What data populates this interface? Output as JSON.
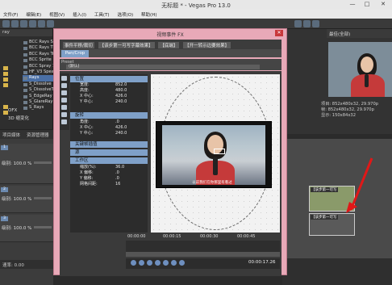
{
  "window": {
    "title": "无标题 * - Vegas Pro 13.0",
    "minimize": "—",
    "maximize": "□",
    "close": "✕"
  },
  "menu": [
    "文件(F)",
    "编辑(E)",
    "视图(V)",
    "插入(I)",
    "工具(T)",
    "选项(O)",
    "帮助(H)"
  ],
  "left_panel": {
    "path": "ray",
    "plugins": [
      "BCC Rays Sh",
      "BCC Rays Ti",
      "BCC Rays Tr",
      "BCC Sprite 1",
      "BCC Spray 1",
      "HF_V3 Spea",
      "Rays",
      "S_Dissolve",
      "S_DissolveT",
      "S_EdgeRay",
      "S_GlareRay",
      "S_Rays"
    ],
    "selected_plugin": "Rays",
    "tree": [
      "OFX",
      "3D 缩变化"
    ],
    "footer_tabs": [
      "项目媒体",
      "资源管理器"
    ]
  },
  "tracks": [
    {
      "num": "1",
      "level_label": "级别: 100.0 %"
    },
    {
      "num": "2",
      "level_label": "级别: 100.0 %"
    },
    {
      "num": "3",
      "level_label": "级别: 100.0 %"
    }
  ],
  "rate_label": "速率: 0.00",
  "dialog": {
    "title": "视频事件 FX",
    "close": "✕",
    "chain": [
      "事件平移/裁切",
      "【该步第一可写字幕效果】",
      "【底端】",
      "【开一转示边要效果】"
    ],
    "tab": "Pan/Crop",
    "preset_label": "Preset",
    "preset_value": "(默认)",
    "sections": {
      "position": "位置",
      "rotation": "旋转",
      "keyframe_interp": "关键帧插值",
      "source": "源",
      "workspace": "工作区"
    },
    "position_rows": [
      {
        "k": "宽度:",
        "v": "852.0"
      },
      {
        "k": "高度:",
        "v": "480.0"
      },
      {
        "k": "X 中心:",
        "v": "426.0"
      },
      {
        "k": "Y 中心:",
        "v": "240.0"
      }
    ],
    "rotation_rows": [
      {
        "k": "角度:",
        "v": ".0"
      },
      {
        "k": "X 中心:",
        "v": "426.0"
      },
      {
        "k": "Y 中心:",
        "v": "240.0"
      }
    ],
    "workspace_rows": [
      {
        "k": "缩放(%):",
        "v": "36.0"
      },
      {
        "k": "X 偏移:",
        "v": ".0"
      },
      {
        "k": "Y 偏移:",
        "v": ".0"
      },
      {
        "k": "网格间距:",
        "v": "16"
      }
    ],
    "subtitle": "以前我们在你那里有看过",
    "ruler": [
      "00:00:00",
      "00:00:15",
      "00:00:30",
      "00:00:45"
    ],
    "timecode": "00:00:17.26"
  },
  "preview": {
    "toolbar": "最佳(全部)",
    "info": [
      "项目: 852x480x32, 29.970p",
      "帧: 852x480x32, 29.970p",
      "显示: 150x84x32"
    ]
  },
  "timeline": {
    "clips": [
      "【该步第一可写",
      "【该步第一可写"
    ]
  }
}
